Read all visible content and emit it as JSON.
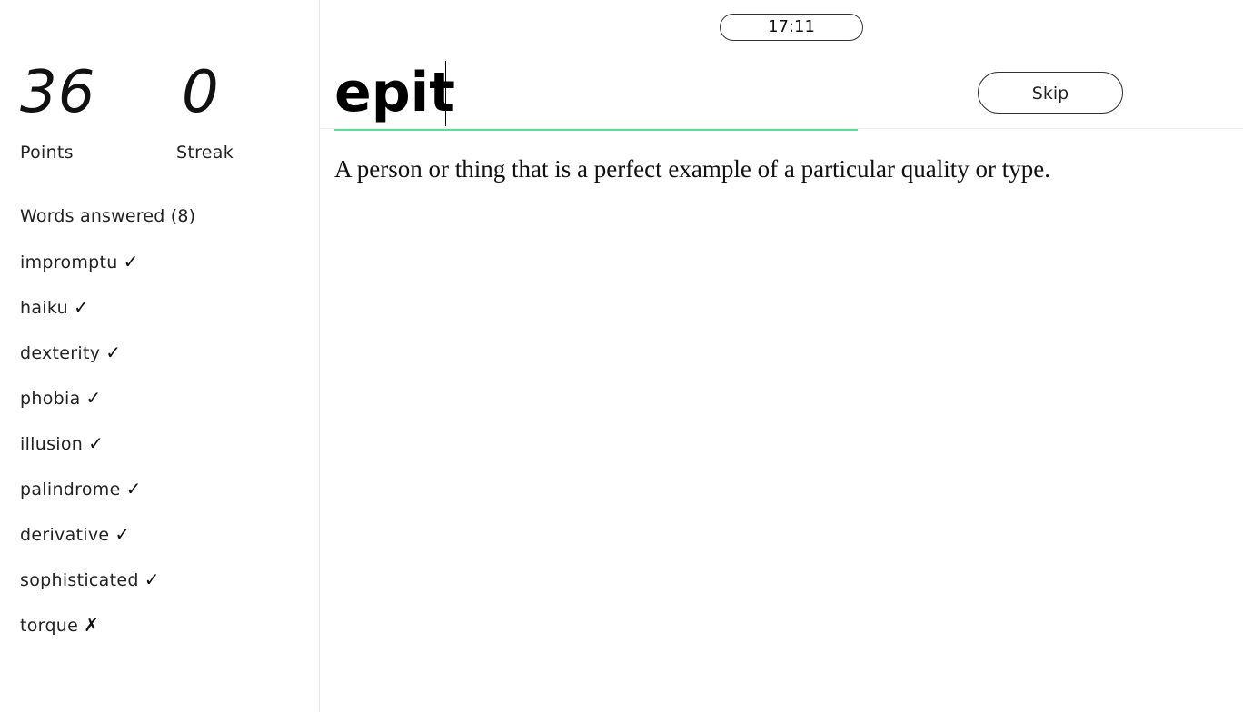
{
  "stats": {
    "points_value": "36",
    "points_label": "Points",
    "streak_value": "0",
    "streak_label": "Streak"
  },
  "answered": {
    "heading": "Words answered (8)",
    "words": [
      {
        "word": "impromptu",
        "mark": "✓"
      },
      {
        "word": "haiku",
        "mark": "✓"
      },
      {
        "word": "dexterity",
        "mark": "✓"
      },
      {
        "word": "phobia",
        "mark": "✓"
      },
      {
        "word": "illusion",
        "mark": "✓"
      },
      {
        "word": "palindrome",
        "mark": "✓"
      },
      {
        "word": "derivative",
        "mark": "✓"
      },
      {
        "word": "sophisticated",
        "mark": "✓"
      },
      {
        "word": "torque",
        "mark": "✗"
      }
    ]
  },
  "timer": {
    "value": "17:11"
  },
  "answer": {
    "value": "epit"
  },
  "skip": {
    "label": "Skip"
  },
  "definition": {
    "text": "A person or thing that is a perfect example of a particular quality or type."
  },
  "colors": {
    "accent_underline": "#5fdc9b"
  }
}
